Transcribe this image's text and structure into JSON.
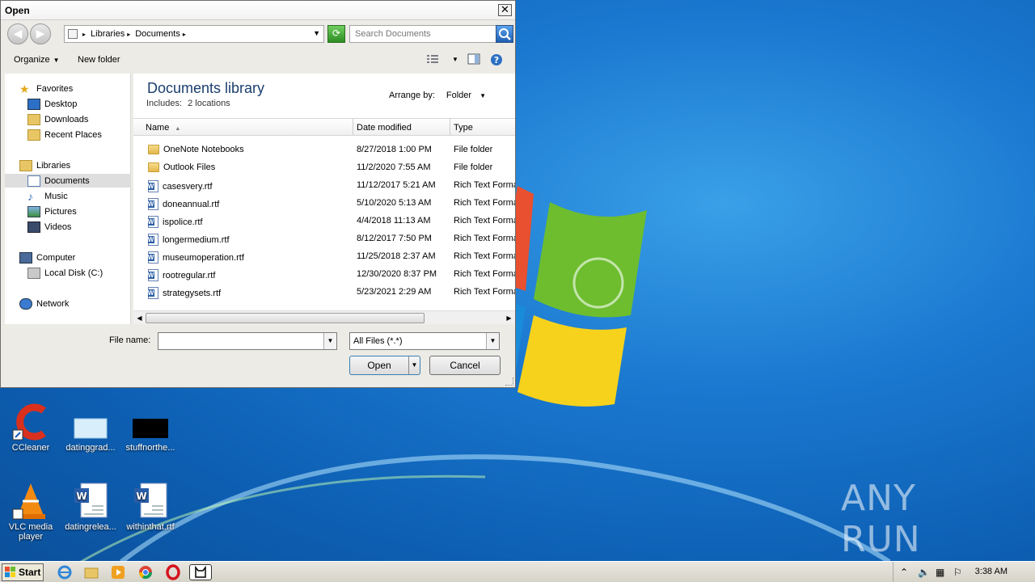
{
  "dialog": {
    "title": "Open",
    "close_glyph": "✕",
    "breadcrumb": [
      "Libraries",
      "Documents"
    ],
    "search_placeholder": "Search Documents",
    "organize_label": "Organize",
    "new_folder_label": "New folder",
    "nav": {
      "favorites_header": "Favorites",
      "favorites": [
        "Desktop",
        "Downloads",
        "Recent Places"
      ],
      "libraries_header": "Libraries",
      "libraries": [
        "Documents",
        "Music",
        "Pictures",
        "Videos"
      ],
      "computer_header": "Computer",
      "computer": [
        "Local Disk (C:)"
      ],
      "network_header": "Network"
    },
    "library_title": "Documents library",
    "includes_label": "Includes:",
    "includes_value": "2 locations",
    "arrange_label": "Arrange by:",
    "arrange_value": "Folder",
    "columns": {
      "name": "Name",
      "date": "Date modified",
      "type": "Type"
    },
    "files": [
      {
        "name": "OneNote Notebooks",
        "date": "8/27/2018 1:00 PM",
        "type": "File folder",
        "kind": "folder"
      },
      {
        "name": "Outlook Files",
        "date": "11/2/2020 7:55 AM",
        "type": "File folder",
        "kind": "folder"
      },
      {
        "name": "casesvery.rtf",
        "date": "11/12/2017 5:21 AM",
        "type": "Rich Text Format",
        "kind": "doc"
      },
      {
        "name": "doneannual.rtf",
        "date": "5/10/2020 5:13 AM",
        "type": "Rich Text Format",
        "kind": "doc"
      },
      {
        "name": "ispolice.rtf",
        "date": "4/4/2018 11:13 AM",
        "type": "Rich Text Format",
        "kind": "doc"
      },
      {
        "name": "longermedium.rtf",
        "date": "8/12/2017 7:50 PM",
        "type": "Rich Text Format",
        "kind": "doc"
      },
      {
        "name": "museumoperation.rtf",
        "date": "11/25/2018 2:37 AM",
        "type": "Rich Text Format",
        "kind": "doc"
      },
      {
        "name": "rootregular.rtf",
        "date": "12/30/2020 8:37 PM",
        "type": "Rich Text Format",
        "kind": "doc"
      },
      {
        "name": "strategysets.rtf",
        "date": "5/23/2021 2:29 AM",
        "type": "Rich Text Format",
        "kind": "doc"
      }
    ],
    "file_name_label": "File name:",
    "file_name_value": "",
    "filter_value": "All Files (*.*)",
    "open_label": "Open",
    "cancel_label": "Cancel"
  },
  "desktop": {
    "icons": [
      {
        "label": "CCleaner",
        "icon": "ccleaner-icon"
      },
      {
        "label": "datinggrad...",
        "icon": "blank-file-icon"
      },
      {
        "label": "stuffnorthe...",
        "icon": "black-thumbnail-icon"
      },
      {
        "label": "VLC media player",
        "icon": "vlc-icon"
      },
      {
        "label": "datingrelea...",
        "icon": "word-doc-icon"
      },
      {
        "label": "withinthat.rtf",
        "icon": "word-doc-icon"
      }
    ],
    "watermark": "ANY RUN"
  },
  "taskbar": {
    "start_label": "Start",
    "clock": "3:38 AM"
  },
  "colors": {
    "desktop_blue": "#1a78cf",
    "dialog_bg": "#ecebe6",
    "library_title": "#1a3e6e"
  }
}
